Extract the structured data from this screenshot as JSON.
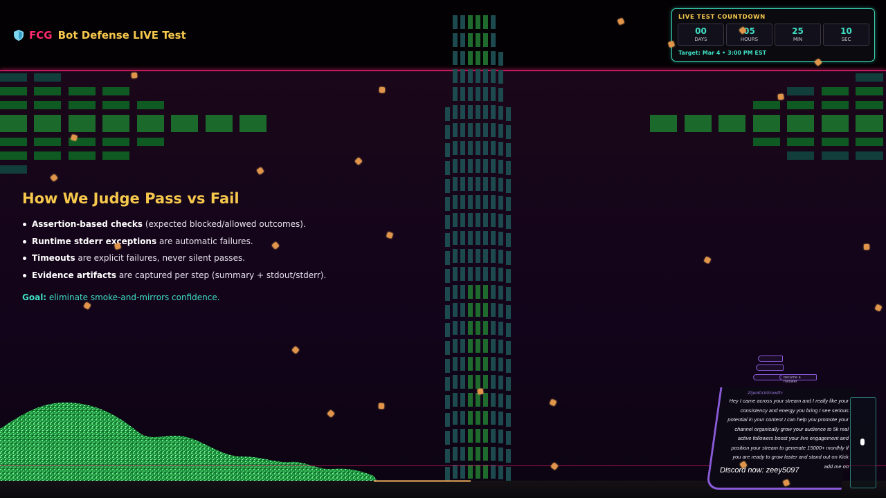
{
  "header": {
    "brand_prefix": "FCG",
    "brand_title": "Bot Defense LIVE Test"
  },
  "countdown": {
    "title": "LIVE TEST COUNTDOWN",
    "units": [
      {
        "value": "00",
        "label": "DAYS"
      },
      {
        "value": "05",
        "label": "HOURS"
      },
      {
        "value": "25",
        "label": "MIN"
      },
      {
        "value": "10",
        "label": "SEC"
      }
    ],
    "target": "Target: Mar 4 • 3:00 PM EST"
  },
  "content": {
    "heading": "How We Judge Pass vs Fail",
    "bullets": [
      {
        "bold": "Assertion-based checks",
        "rest": " (expected blocked/allowed outcomes)."
      },
      {
        "bold": "Runtime stderr exceptions",
        "rest": " are automatic failures."
      },
      {
        "bold": "Timeouts",
        "rest": " are explicit failures, never silent passes."
      },
      {
        "bold": "Evidence artifacts",
        "rest": " are captured per step (summary + stdout/stderr)."
      }
    ],
    "goal_label": "Goal:",
    "goal_text": " eliminate smoke-and-mirrors confidence."
  },
  "chat": {
    "small_messages": [
      "",
      "",
      "",
      "became a follower"
    ],
    "main_user": "ZijenKickGrowth:",
    "main_text": "Hey I came across your stream and I really like your consistency and energy you bring I see serious potential in your content I can help you promote your channel organically grow your audience to 5k real active followers boost your live engagement and position your stream to generate 15000+ monthly If you are ready to grow faster and stand out on Kick add me on",
    "discord": "Discord now: zeey5097"
  },
  "colors": {
    "accent_pink": "#ff2a6d",
    "accent_gold": "#f6c84c",
    "accent_teal": "#3fe0c4",
    "chat_purple": "#8a5bd8"
  },
  "icons": [
    "shield-icon"
  ]
}
